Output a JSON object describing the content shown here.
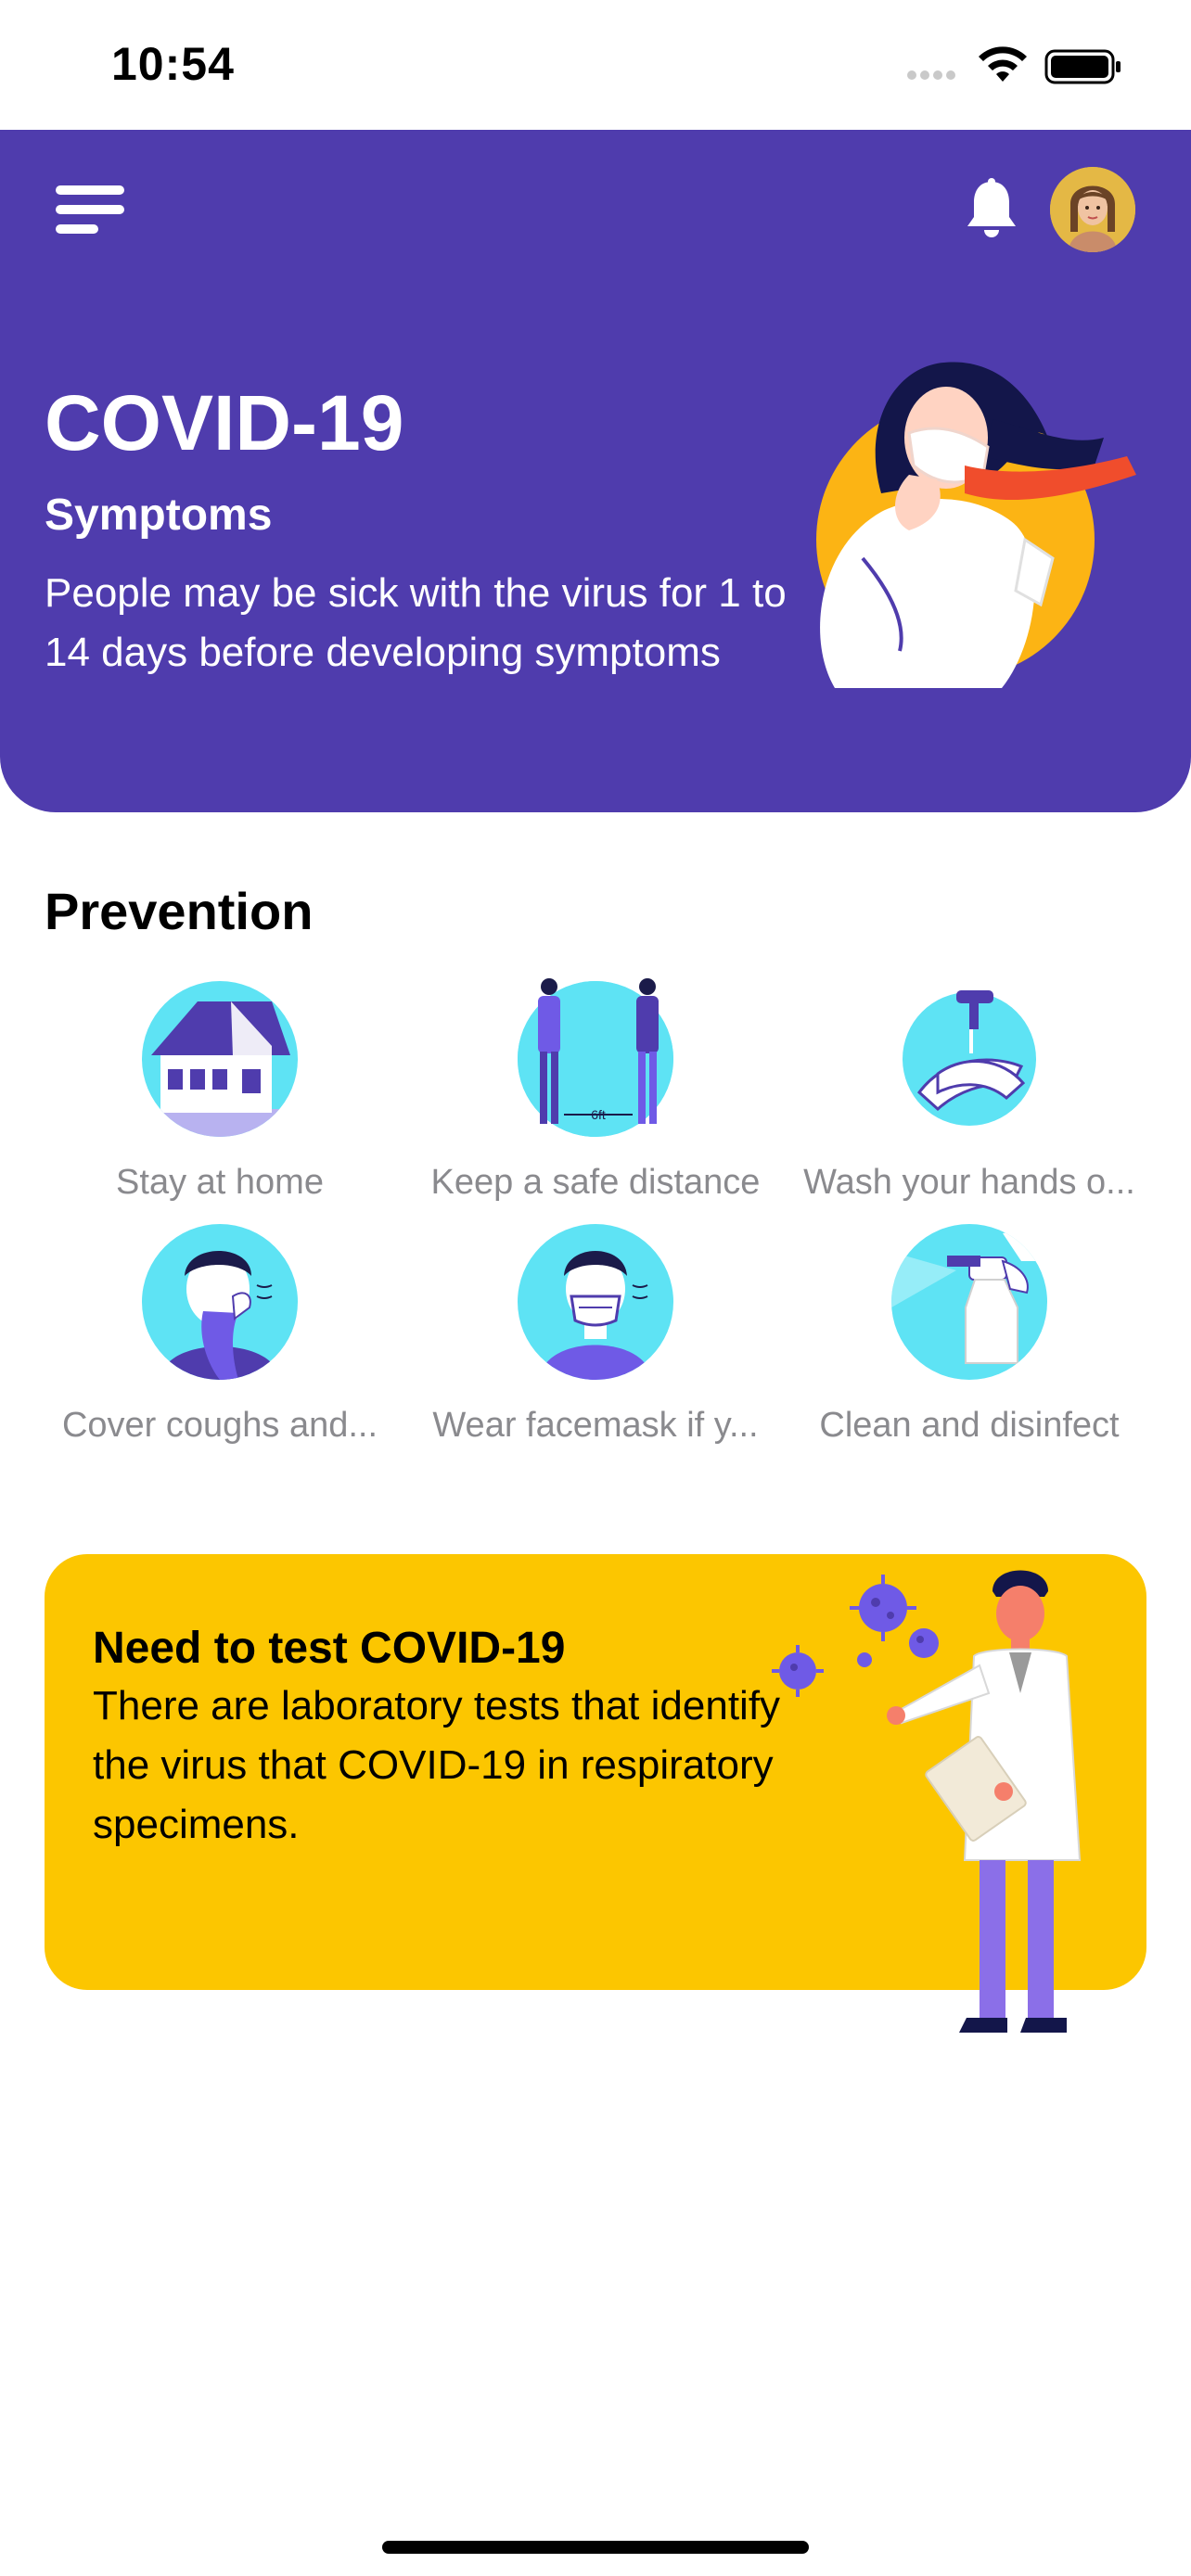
{
  "status_bar": {
    "time": "10:54"
  },
  "header": {
    "title": "COVID-19",
    "subtitle": "Symptoms",
    "body": "People may be sick with the virus for 1 to 14 days before developing symptoms",
    "menu_icon": "menu-icon",
    "notification_icon": "bell-icon",
    "avatar": "user-avatar",
    "background_color": "#4f3cad"
  },
  "prevention": {
    "title": "Prevention",
    "items": [
      {
        "label": "Stay at home",
        "icon": "house-icon"
      },
      {
        "label": "Keep a safe distance",
        "icon": "distance-icon",
        "distance_text": "6ft"
      },
      {
        "label": "Wash your hands o...",
        "icon": "wash-hands-icon"
      },
      {
        "label": "Cover coughs and...",
        "icon": "cover-cough-icon"
      },
      {
        "label": "Wear facemask if y...",
        "icon": "facemask-icon"
      },
      {
        "label": "Clean and disinfect",
        "icon": "spray-bottle-icon"
      }
    ]
  },
  "test_card": {
    "title": "Need to test COVID-19",
    "body": "There are laboratory tests that identify the virus that COVID-19 in respiratory specimens.",
    "background_color": "#fcc600"
  }
}
